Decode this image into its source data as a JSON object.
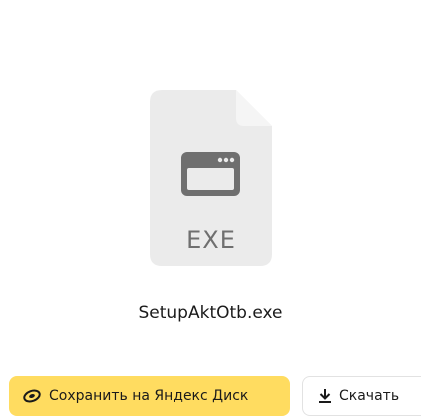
{
  "file": {
    "name": "SetupAktOtb.exe",
    "extension": "EXE",
    "icon": "exe-file-icon"
  },
  "actions": {
    "save_label": "Сохранить на Яндекс Диск",
    "save_icon": "disk-save-icon",
    "download_label": "Скачать",
    "download_icon": "download-icon"
  },
  "colors": {
    "save_button_bg": "#ffdc60",
    "file_icon_fill": "#ebebeb",
    "file_icon_glyph": "#6f6f6f"
  }
}
